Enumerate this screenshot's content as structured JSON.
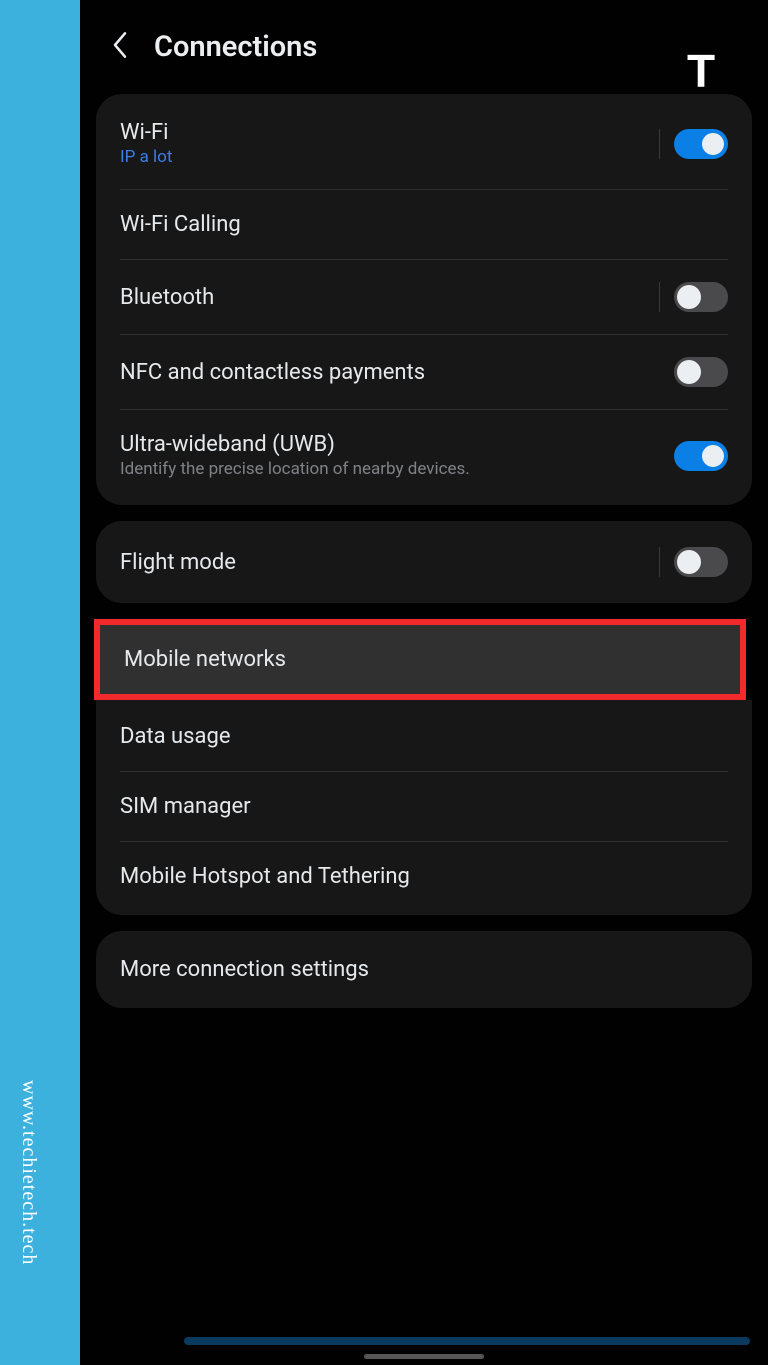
{
  "header": {
    "title": "Connections"
  },
  "group1": {
    "wifi": {
      "title": "Wi-Fi",
      "sub": "IP a lot",
      "on": true
    },
    "wifiCalling": {
      "title": "Wi-Fi Calling"
    },
    "bluetooth": {
      "title": "Bluetooth",
      "on": false
    },
    "nfc": {
      "title": "NFC and contactless payments",
      "on": false
    },
    "uwb": {
      "title": "Ultra-wideband (UWB)",
      "desc": "Identify the precise location of nearby devices.",
      "on": true
    }
  },
  "group2": {
    "flight": {
      "title": "Flight mode",
      "on": false
    }
  },
  "group3": {
    "mobile": {
      "title": "Mobile networks"
    },
    "data": {
      "title": "Data usage"
    },
    "sim": {
      "title": "SIM manager"
    },
    "hotspot": {
      "title": "Mobile Hotspot and Tethering"
    }
  },
  "group4": {
    "more": {
      "title": "More connection settings"
    }
  },
  "watermark": "www.techietech.tech",
  "logo_letter": "T"
}
